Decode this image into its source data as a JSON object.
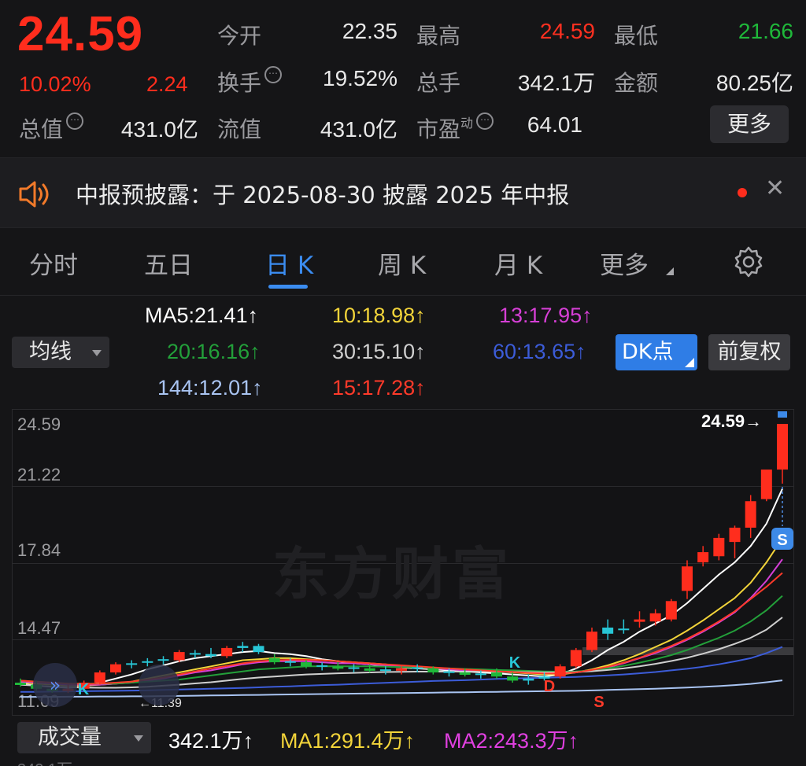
{
  "quote": {
    "price": "24.59",
    "change_pct": "10.02%",
    "change_amt": "2.24",
    "fields": {
      "open_label": "今开",
      "open_value": "22.35",
      "high_label": "最高",
      "high_value": "24.59",
      "low_label": "最低",
      "low_value": "21.66",
      "turnover_label": "换手",
      "turnover_value": "19.52%",
      "volume_label": "总手",
      "volume_value": "342.1万",
      "amount_label": "金额",
      "amount_value": "80.25亿",
      "mktcap_label": "总值",
      "mktcap_value": "431.0亿",
      "float_label": "流值",
      "float_value": "431.0亿",
      "pe_label": "市盈",
      "pe_sup": "动",
      "pe_value": "64.01"
    },
    "more_label": "更多",
    "info_glyph": "⋯"
  },
  "notice": {
    "text": "中报预披露：于 2025-08-30 披露 2025 年中报",
    "close_glyph": "✕"
  },
  "tabs": {
    "items": [
      "分时",
      "五日",
      "日 K",
      "周 K",
      "月 K",
      "更多"
    ],
    "active_index": 2
  },
  "ma_legend": {
    "selector_label": "均线",
    "ma5": "MA5:21.41↑",
    "ma10": "10:18.98↑",
    "ma13": "13:17.95↑",
    "ma20": "20:16.16↑",
    "ma30": "30:15.10↑",
    "ma60": "60:13.65↑",
    "ma144": "144:12.01↑",
    "ma15": "15:17.28↑",
    "dk_label": "DK点",
    "adjust_label": "前复权"
  },
  "colors": {
    "up": "#ff2d1d",
    "down": "#1fb83a",
    "ma5": "#ffffff",
    "ma10": "#f2d43a",
    "ma13": "#d63fd6",
    "ma20": "#23a03a",
    "ma30": "#cfcfcf",
    "ma60": "#3c5cd8",
    "ma144": "#a9c4f2",
    "ma15": "#ff3a2a",
    "flat_candle": "#28c6d6",
    "accent": "#3b8cf0"
  },
  "chart": {
    "y_ticks": [
      "24.59",
      "21.22",
      "17.84",
      "14.47",
      "11.09"
    ],
    "last_price_label": "24.59→",
    "watermark": "东方财富",
    "marker_s_top": "S",
    "marker_k": "K",
    "marker_d": "D",
    "marker_s_bottom": "S",
    "low_label": "11.39"
  },
  "chart_data": {
    "type": "candlestick",
    "y_range": [
      11.09,
      24.59
    ],
    "y_ticks": [
      24.59,
      21.22,
      17.84,
      14.47,
      11.09
    ],
    "last_price": 24.59,
    "candles": [
      {
        "o": 11.9,
        "h": 12.1,
        "l": 11.7,
        "c": 11.8,
        "flat": false
      },
      {
        "o": 11.8,
        "h": 12.0,
        "l": 11.5,
        "c": 11.6,
        "flat": false
      },
      {
        "o": 11.6,
        "h": 11.9,
        "l": 11.4,
        "c": 11.5,
        "flat": false
      },
      {
        "o": 11.5,
        "h": 11.8,
        "l": 11.39,
        "c": 11.6,
        "flat": false
      },
      {
        "o": 11.6,
        "h": 12.0,
        "l": 11.5,
        "c": 11.9,
        "flat": false
      },
      {
        "o": 11.9,
        "h": 12.5,
        "l": 11.8,
        "c": 12.4,
        "flat": false
      },
      {
        "o": 12.4,
        "h": 12.9,
        "l": 12.3,
        "c": 12.8,
        "flat": false
      },
      {
        "o": 12.8,
        "h": 13.0,
        "l": 12.6,
        "c": 12.85,
        "flat": true
      },
      {
        "o": 12.9,
        "h": 13.1,
        "l": 12.7,
        "c": 12.95,
        "flat": true
      },
      {
        "o": 13.0,
        "h": 13.2,
        "l": 12.8,
        "c": 13.05,
        "flat": true
      },
      {
        "o": 13.0,
        "h": 13.5,
        "l": 12.9,
        "c": 13.4,
        "flat": false
      },
      {
        "o": 13.3,
        "h": 13.5,
        "l": 13.1,
        "c": 13.35,
        "flat": true
      },
      {
        "o": 13.3,
        "h": 13.6,
        "l": 13.1,
        "c": 13.2,
        "flat": true
      },
      {
        "o": 13.2,
        "h": 13.7,
        "l": 13.1,
        "c": 13.6,
        "flat": false
      },
      {
        "o": 13.6,
        "h": 13.9,
        "l": 13.4,
        "c": 13.7,
        "flat": true
      },
      {
        "o": 13.7,
        "h": 13.8,
        "l": 13.3,
        "c": 13.4,
        "flat": true
      },
      {
        "o": 13.1,
        "h": 13.3,
        "l": 12.8,
        "c": 12.9,
        "flat": false
      },
      {
        "o": 12.9,
        "h": 13.1,
        "l": 12.7,
        "c": 12.95,
        "flat": true
      },
      {
        "o": 12.9,
        "h": 13.0,
        "l": 12.6,
        "c": 12.7,
        "flat": false
      },
      {
        "o": 12.7,
        "h": 12.9,
        "l": 12.5,
        "c": 12.75,
        "flat": true
      },
      {
        "o": 12.7,
        "h": 12.9,
        "l": 12.5,
        "c": 12.6,
        "flat": false
      },
      {
        "o": 12.6,
        "h": 12.8,
        "l": 12.4,
        "c": 12.65,
        "flat": true
      },
      {
        "o": 12.6,
        "h": 12.8,
        "l": 12.4,
        "c": 12.5,
        "flat": false
      },
      {
        "o": 12.5,
        "h": 12.7,
        "l": 12.3,
        "c": 12.55,
        "flat": true
      },
      {
        "o": 12.5,
        "h": 12.7,
        "l": 12.3,
        "c": 12.6,
        "flat": false
      },
      {
        "o": 12.6,
        "h": 12.8,
        "l": 12.4,
        "c": 12.65,
        "flat": true
      },
      {
        "o": 12.6,
        "h": 12.7,
        "l": 12.3,
        "c": 12.4,
        "flat": false
      },
      {
        "o": 12.4,
        "h": 12.6,
        "l": 12.2,
        "c": 12.45,
        "flat": true
      },
      {
        "o": 12.4,
        "h": 12.6,
        "l": 12.2,
        "c": 12.3,
        "flat": false
      },
      {
        "o": 12.3,
        "h": 12.5,
        "l": 12.1,
        "c": 12.35,
        "flat": true
      },
      {
        "o": 12.4,
        "h": 12.6,
        "l": 12.1,
        "c": 12.2,
        "flat": false
      },
      {
        "o": 12.2,
        "h": 12.4,
        "l": 11.9,
        "c": 12.0,
        "flat": false
      },
      {
        "o": 12.0,
        "h": 12.3,
        "l": 11.8,
        "c": 12.1,
        "flat": true
      },
      {
        "o": 12.1,
        "h": 12.4,
        "l": 12.0,
        "c": 12.2,
        "flat": true
      },
      {
        "o": 12.2,
        "h": 12.8,
        "l": 12.1,
        "c": 12.7,
        "flat": false
      },
      {
        "o": 12.7,
        "h": 13.6,
        "l": 12.6,
        "c": 13.5,
        "flat": false
      },
      {
        "o": 13.5,
        "h": 14.6,
        "l": 13.4,
        "c": 14.4,
        "flat": false
      },
      {
        "o": 14.3,
        "h": 15.0,
        "l": 14.0,
        "c": 14.6,
        "flat": true
      },
      {
        "o": 14.5,
        "h": 15.0,
        "l": 14.3,
        "c": 14.55,
        "flat": true
      },
      {
        "o": 14.9,
        "h": 15.4,
        "l": 14.6,
        "c": 15.0,
        "flat": false
      },
      {
        "o": 14.9,
        "h": 15.5,
        "l": 14.7,
        "c": 15.3,
        "flat": false
      },
      {
        "o": 15.0,
        "h": 16.0,
        "l": 14.9,
        "c": 15.9,
        "flat": false
      },
      {
        "o": 16.4,
        "h": 17.9,
        "l": 16.0,
        "c": 17.6,
        "flat": false
      },
      {
        "o": 17.8,
        "h": 18.6,
        "l": 17.6,
        "c": 18.3,
        "flat": false
      },
      {
        "o": 18.1,
        "h": 19.2,
        "l": 17.9,
        "c": 19.0,
        "flat": false
      },
      {
        "o": 18.8,
        "h": 19.6,
        "l": 18.0,
        "c": 19.5,
        "flat": false
      },
      {
        "o": 19.5,
        "h": 21.1,
        "l": 19.0,
        "c": 20.8,
        "flat": false
      },
      {
        "o": 20.9,
        "h": 22.3,
        "l": 20.8,
        "c": 22.35,
        "flat": false
      },
      {
        "o": 22.35,
        "h": 24.59,
        "l": 21.66,
        "c": 24.59,
        "flat": false
      }
    ],
    "ma_lines": [
      {
        "name": "MA5",
        "values": [
          11.85,
          11.75,
          11.7,
          11.65,
          11.7,
          11.9,
          12.1,
          12.3,
          12.55,
          12.75,
          12.95,
          13.1,
          13.2,
          13.3,
          13.4,
          13.45,
          13.35,
          13.3,
          13.2,
          13.05,
          12.95,
          12.85,
          12.8,
          12.7,
          12.65,
          12.6,
          12.55,
          12.5,
          12.45,
          12.4,
          12.35,
          12.3,
          12.25,
          12.2,
          12.3,
          12.6,
          13.0,
          13.5,
          13.9,
          14.4,
          14.8,
          15.2,
          15.8,
          16.5,
          17.2,
          17.8,
          18.6,
          19.7,
          21.41
        ]
      },
      {
        "name": "10",
        "values": [
          11.9,
          11.85,
          11.8,
          11.75,
          11.75,
          11.8,
          11.85,
          11.95,
          12.1,
          12.25,
          12.4,
          12.55,
          12.7,
          12.85,
          13.0,
          13.05,
          13.1,
          13.1,
          13.05,
          13.0,
          12.95,
          12.9,
          12.85,
          12.8,
          12.7,
          12.65,
          12.6,
          12.55,
          12.5,
          12.45,
          12.45,
          12.4,
          12.35,
          12.3,
          12.3,
          12.4,
          12.55,
          12.75,
          13.0,
          13.3,
          13.65,
          14.0,
          14.45,
          14.95,
          15.5,
          16.05,
          16.8,
          17.8,
          18.98
        ]
      },
      {
        "name": "13",
        "values": [
          11.95,
          11.9,
          11.85,
          11.8,
          11.8,
          11.8,
          11.85,
          11.9,
          12.0,
          12.1,
          12.25,
          12.4,
          12.5,
          12.65,
          12.8,
          12.9,
          12.95,
          12.95,
          12.95,
          12.9,
          12.85,
          12.85,
          12.8,
          12.75,
          12.7,
          12.65,
          12.6,
          12.55,
          12.5,
          12.5,
          12.45,
          12.45,
          12.4,
          12.35,
          12.35,
          12.4,
          12.5,
          12.65,
          12.85,
          13.1,
          13.35,
          13.65,
          14.0,
          14.4,
          14.85,
          15.35,
          16.05,
          16.9,
          17.95
        ]
      },
      {
        "name": "20",
        "values": [
          12.0,
          11.95,
          11.9,
          11.85,
          11.85,
          11.85,
          11.85,
          11.9,
          11.95,
          12.0,
          12.05,
          12.15,
          12.25,
          12.35,
          12.45,
          12.55,
          12.6,
          12.65,
          12.7,
          12.7,
          12.7,
          12.7,
          12.7,
          12.68,
          12.66,
          12.64,
          12.62,
          12.6,
          12.57,
          12.55,
          12.52,
          12.5,
          12.48,
          12.45,
          12.44,
          12.45,
          12.5,
          12.6,
          12.72,
          12.88,
          13.05,
          13.25,
          13.5,
          13.8,
          14.1,
          14.45,
          14.9,
          15.45,
          16.16
        ]
      },
      {
        "name": "30",
        "values": [
          11.8,
          11.75,
          11.7,
          11.68,
          11.66,
          11.65,
          11.65,
          11.67,
          11.7,
          11.75,
          11.8,
          11.86,
          11.92,
          12.0,
          12.08,
          12.15,
          12.2,
          12.25,
          12.3,
          12.33,
          12.36,
          12.38,
          12.4,
          12.42,
          12.43,
          12.44,
          12.44,
          12.44,
          12.44,
          12.44,
          12.43,
          12.42,
          12.41,
          12.4,
          12.4,
          12.42,
          12.46,
          12.52,
          12.6,
          12.7,
          12.82,
          12.96,
          13.12,
          13.32,
          13.54,
          13.8,
          14.1,
          14.5,
          15.1
        ]
      },
      {
        "name": "60",
        "values": [
          11.45,
          11.45,
          11.46,
          11.47,
          11.48,
          11.49,
          11.5,
          11.51,
          11.52,
          11.54,
          11.56,
          11.58,
          11.6,
          11.62,
          11.64,
          11.67,
          11.7,
          11.72,
          11.75,
          11.78,
          11.8,
          11.83,
          11.86,
          11.89,
          11.92,
          11.95,
          11.98,
          12.0,
          12.02,
          12.05,
          12.08,
          12.1,
          12.12,
          12.14,
          12.16,
          12.18,
          12.22,
          12.26,
          12.3,
          12.36,
          12.42,
          12.5,
          12.58,
          12.68,
          12.8,
          12.94,
          13.1,
          13.35,
          13.65
        ]
      },
      {
        "name": "144",
        "values": [
          11.2,
          11.2,
          11.2,
          11.21,
          11.21,
          11.22,
          11.22,
          11.23,
          11.23,
          11.24,
          11.25,
          11.26,
          11.27,
          11.28,
          11.29,
          11.3,
          11.31,
          11.32,
          11.33,
          11.34,
          11.35,
          11.36,
          11.37,
          11.38,
          11.39,
          11.4,
          11.41,
          11.42,
          11.43,
          11.44,
          11.45,
          11.46,
          11.47,
          11.48,
          11.49,
          11.5,
          11.52,
          11.54,
          11.56,
          11.58,
          11.6,
          11.63,
          11.66,
          11.69,
          11.73,
          11.78,
          11.84,
          11.92,
          12.01
        ]
      },
      {
        "name": "15",
        "values": [
          12.0,
          11.95,
          11.9,
          11.85,
          11.83,
          11.85,
          11.9,
          11.95,
          12.05,
          12.15,
          12.3,
          12.45,
          12.6,
          12.72,
          12.85,
          12.95,
          13.0,
          13.02,
          13.02,
          13.0,
          12.95,
          12.9,
          12.85,
          12.8,
          12.75,
          12.7,
          12.65,
          12.6,
          12.55,
          12.5,
          12.46,
          12.42,
          12.38,
          12.35,
          12.35,
          12.4,
          12.52,
          12.68,
          12.88,
          13.12,
          13.4,
          13.7,
          14.05,
          14.45,
          14.9,
          15.4,
          16.0,
          16.6,
          17.28
        ]
      }
    ]
  },
  "volume": {
    "selector_label": "成交量",
    "vol": "342.1万↑",
    "ma1": "MA1:291.4万↑",
    "ma2": "MA2:243.3万↑",
    "partial_label": "342.1万"
  }
}
